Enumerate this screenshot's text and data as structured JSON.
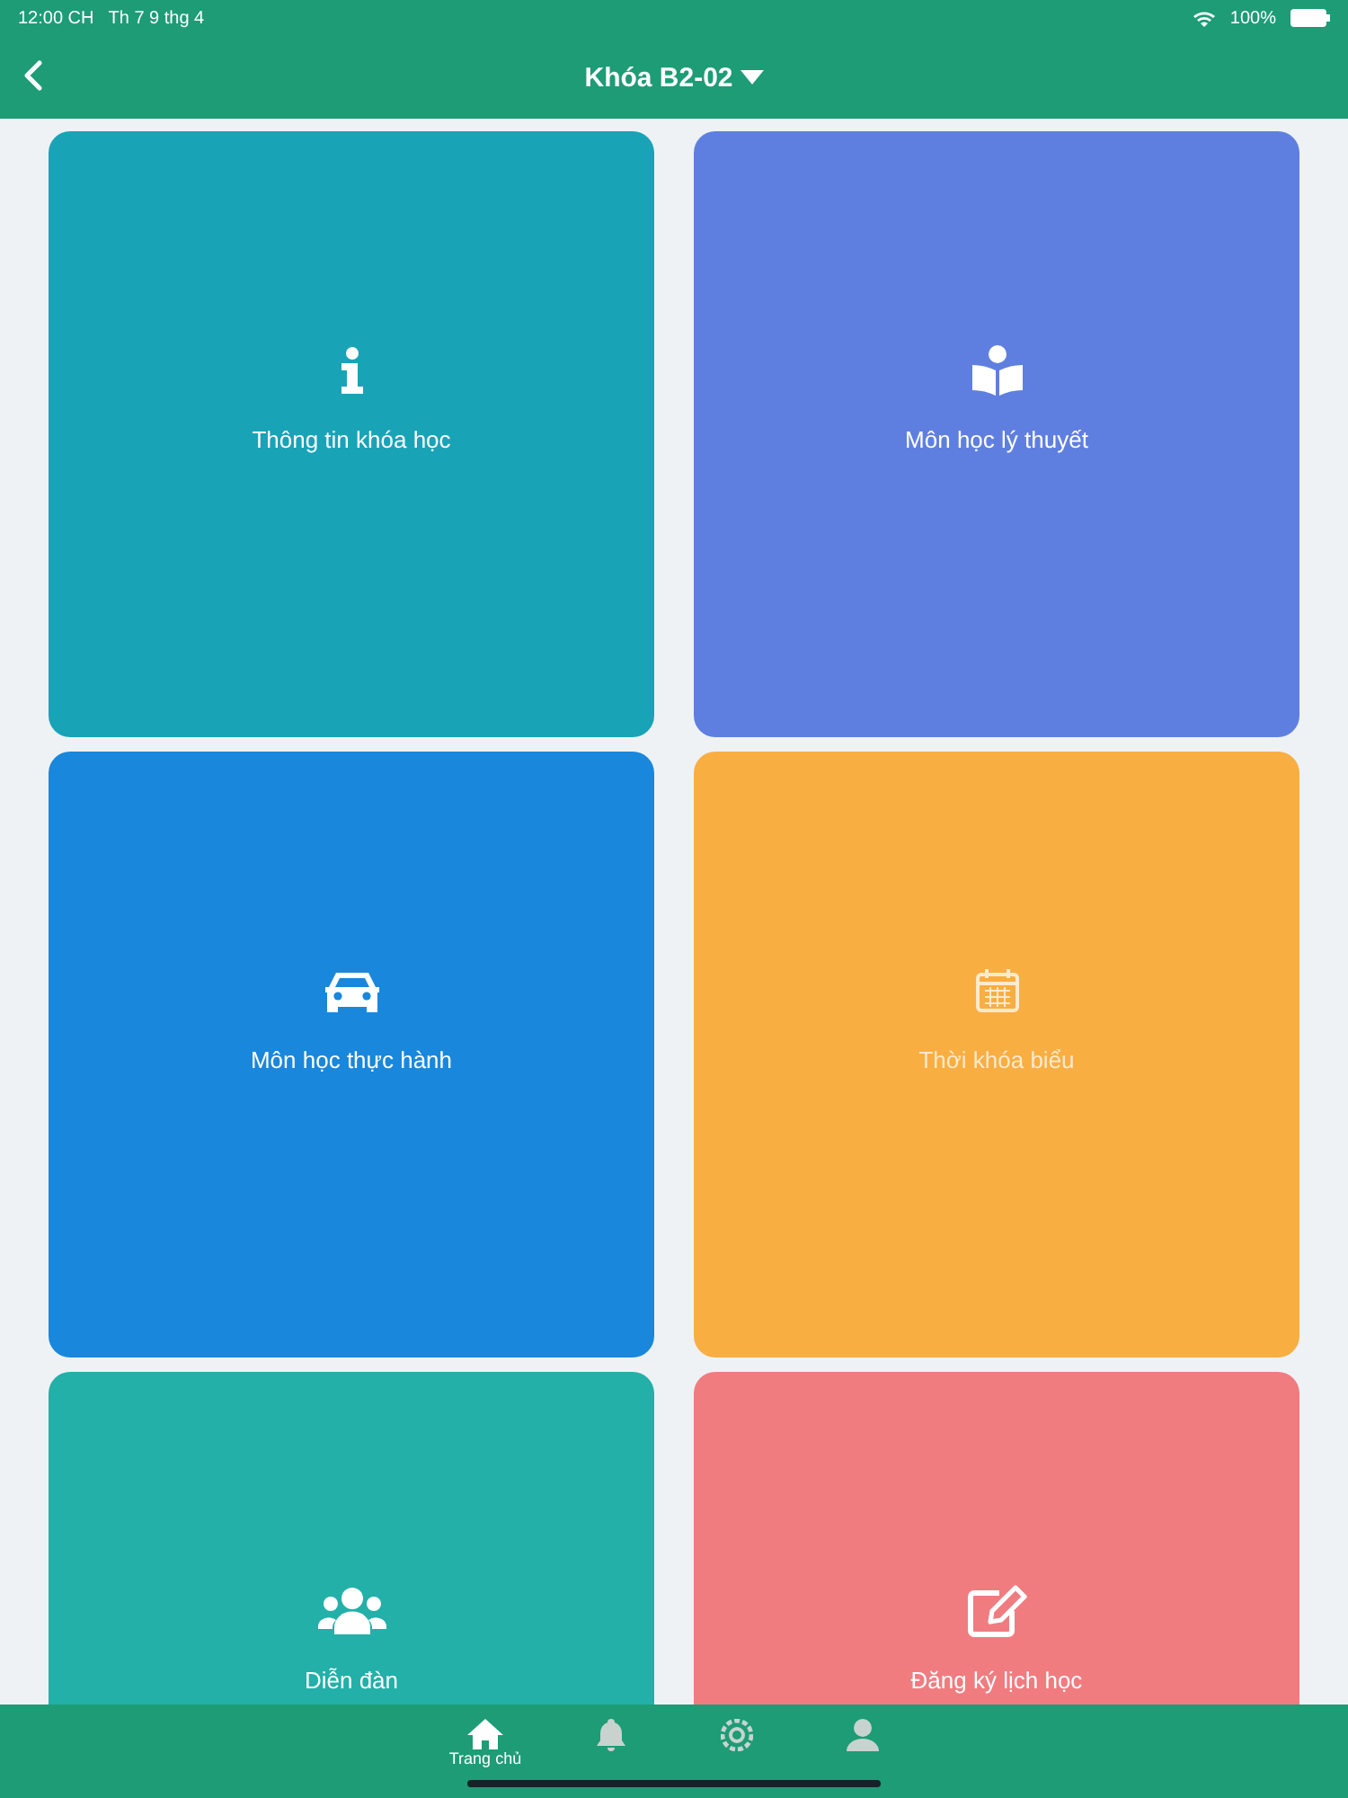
{
  "status_bar": {
    "time": "12:00 CH",
    "date": "Th 7 9 thg 4",
    "battery": "100%"
  },
  "header": {
    "title": "Khóa B2-02"
  },
  "tiles": [
    {
      "label": "Thông tin khóa học",
      "color": "#19a3b7"
    },
    {
      "label": "Môn học lý thuyết",
      "color": "#5f7fe0"
    },
    {
      "label": "Môn học thực hành",
      "color": "#1987dc"
    },
    {
      "label": "Thời khóa biểu",
      "color": "#f9ae42"
    },
    {
      "label": "Diễn đàn",
      "color": "#22b0a8"
    },
    {
      "label": "Đăng ký lịch học",
      "color": "#f07c80"
    }
  ],
  "tab_bar": [
    {
      "label": "Trang chủ",
      "selected": true
    },
    {
      "selected": false
    },
    {
      "selected": false
    },
    {
      "selected": false
    }
  ]
}
